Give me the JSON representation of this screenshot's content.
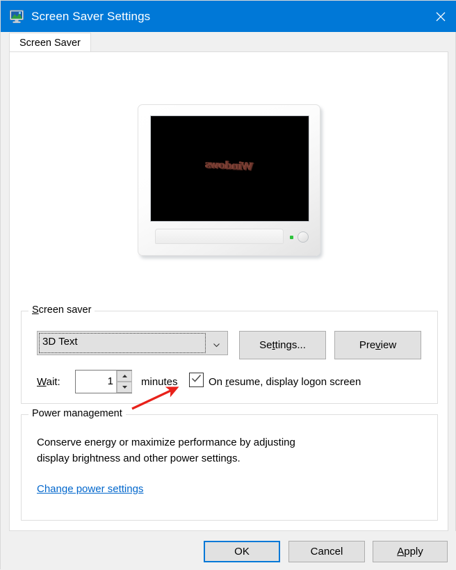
{
  "window": {
    "title": "Screen Saver Settings",
    "app_icon": "monitor-screensaver-icon",
    "close_icon": "close-icon"
  },
  "tabs": [
    {
      "label": "Screen Saver",
      "selected": true
    }
  ],
  "preview": {
    "monitor_icon": "monitor-preview",
    "screensaver_text": "Windows",
    "led_color": "#2ec23c",
    "screen_color": "#000000"
  },
  "screen_saver_group": {
    "legend_pre": "S",
    "legend_post": "creen saver",
    "combo": {
      "value": "3D Text",
      "arrow_icon": "chevron-down-icon"
    },
    "settings_button": {
      "pre": "Se",
      "accel": "t",
      "post": "tings..."
    },
    "preview_button": {
      "pre": "Pre",
      "accel": "v",
      "post": "iew"
    },
    "wait": {
      "label_accel": "W",
      "label_post": "ait:",
      "value": "1",
      "unit": "minutes",
      "spin_up_icon": "triangle-up-icon",
      "spin_down_icon": "triangle-down-icon"
    },
    "resume_checkbox": {
      "checked": true,
      "check_icon": "checkmark-icon",
      "label_pre": "On ",
      "label_accel": "r",
      "label_post": "esume, display logon screen"
    }
  },
  "power_group": {
    "legend": "Power management",
    "description_line1": "Conserve energy or maximize performance by adjusting",
    "description_line2": "display brightness and other power settings.",
    "link": "Change power settings",
    "link_color": "#0066cc"
  },
  "annotation": {
    "arrow_icon": "red-arrow-annotation",
    "color": "#e8211a"
  },
  "footer": {
    "ok": "OK",
    "cancel": "Cancel",
    "apply_pre": "A",
    "apply_post": "pply"
  },
  "colors": {
    "titlebar": "#0078d7",
    "accent": "#0078d7",
    "dialog_bg": "#f0f0f0",
    "panel_bg": "#ffffff",
    "button_face": "#e1e1e1"
  }
}
